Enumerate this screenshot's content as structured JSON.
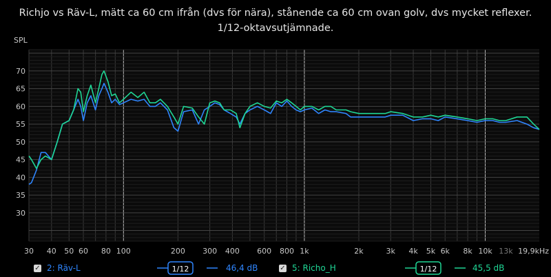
{
  "title_lines": [
    "Richjo vs Räv-L, mätt ca 60 cm ifrån (dvs för nära), stånende ca 60 cm ovan golv, dvs mycket reflexer.",
    "1/12-oktavsutjämnade."
  ],
  "colors": {
    "rav": "#2f86ff",
    "richo": "#1fd796",
    "grid": "#3a3a3a",
    "grid_major": "#bdbdbd",
    "text": "#c8c8c8"
  },
  "chart_data": {
    "type": "line",
    "title": "Richjo vs Räv-L, mätt ca 60 cm ifrån (dvs för nära), stånende ca 60 cm ovan golv, dvs mycket reflexer. 1/12-oktavsutjämnade.",
    "xlabel": "Hz",
    "ylabel": "SPL",
    "xscale": "log",
    "xlim": [
      30,
      19900
    ],
    "ylim": [
      22,
      76
    ],
    "grid": true,
    "y_ticks": [
      30,
      35,
      40,
      45,
      50,
      55,
      60,
      65,
      70
    ],
    "x_ticks": [
      {
        "v": 30,
        "label": "30"
      },
      {
        "v": 40,
        "label": "40"
      },
      {
        "v": 50,
        "label": "50"
      },
      {
        "v": 60,
        "label": "60"
      },
      {
        "v": 80,
        "label": "80"
      },
      {
        "v": 100,
        "label": "100"
      },
      {
        "v": 200,
        "label": "200"
      },
      {
        "v": 300,
        "label": "300"
      },
      {
        "v": 400,
        "label": "400"
      },
      {
        "v": 600,
        "label": "600"
      },
      {
        "v": 800,
        "label": "800"
      },
      {
        "v": 1000,
        "label": "1k"
      },
      {
        "v": 2000,
        "label": "2k"
      },
      {
        "v": 3000,
        "label": "3k"
      },
      {
        "v": 4000,
        "label": "4k"
      },
      {
        "v": 5000,
        "label": "5k"
      },
      {
        "v": 6000,
        "label": "6k"
      },
      {
        "v": 8000,
        "label": "8k"
      },
      {
        "v": 10000,
        "label": "10k"
      },
      {
        "v": 13000,
        "label": "13k"
      },
      {
        "v": 19900,
        "label": "19,9kHz"
      }
    ],
    "series": [
      {
        "name": "2: Räv-L",
        "color": "#2f86ff",
        "points": [
          [
            30,
            38
          ],
          [
            31,
            38.5
          ],
          [
            33,
            42
          ],
          [
            35,
            47
          ],
          [
            37,
            47
          ],
          [
            40,
            45
          ],
          [
            43,
            50
          ],
          [
            46,
            55
          ],
          [
            50,
            56
          ],
          [
            53,
            59
          ],
          [
            56,
            62
          ],
          [
            58,
            60
          ],
          [
            60,
            56
          ],
          [
            63,
            61
          ],
          [
            66,
            63
          ],
          [
            70,
            59
          ],
          [
            73,
            63
          ],
          [
            76,
            65
          ],
          [
            78,
            66.5
          ],
          [
            82,
            64
          ],
          [
            86,
            61
          ],
          [
            90,
            62
          ],
          [
            95,
            60.5
          ],
          [
            100,
            61
          ],
          [
            110,
            62
          ],
          [
            120,
            61.5
          ],
          [
            130,
            62
          ],
          [
            140,
            60
          ],
          [
            150,
            60
          ],
          [
            160,
            61
          ],
          [
            175,
            59
          ],
          [
            190,
            54
          ],
          [
            200,
            53
          ],
          [
            215,
            58.5
          ],
          [
            240,
            59
          ],
          [
            260,
            55
          ],
          [
            280,
            59
          ],
          [
            300,
            60
          ],
          [
            320,
            61
          ],
          [
            340,
            60.5
          ],
          [
            360,
            59
          ],
          [
            390,
            58
          ],
          [
            420,
            57
          ],
          [
            440,
            55
          ],
          [
            470,
            58
          ],
          [
            500,
            59
          ],
          [
            550,
            60
          ],
          [
            600,
            59
          ],
          [
            650,
            58
          ],
          [
            700,
            61
          ],
          [
            750,
            60
          ],
          [
            800,
            61.5
          ],
          [
            850,
            60
          ],
          [
            900,
            59
          ],
          [
            950,
            58.5
          ],
          [
            1000,
            59
          ],
          [
            1100,
            59.5
          ],
          [
            1200,
            58
          ],
          [
            1300,
            59
          ],
          [
            1400,
            58.5
          ],
          [
            1500,
            58.5
          ],
          [
            1700,
            58
          ],
          [
            1800,
            57
          ],
          [
            2000,
            57
          ],
          [
            2200,
            57
          ],
          [
            2500,
            57
          ],
          [
            2800,
            57
          ],
          [
            3000,
            57.5
          ],
          [
            3500,
            57.5
          ],
          [
            4000,
            56
          ],
          [
            4500,
            56.5
          ],
          [
            5000,
            56.5
          ],
          [
            5500,
            56
          ],
          [
            6000,
            57
          ],
          [
            7000,
            56.5
          ],
          [
            8000,
            56
          ],
          [
            9000,
            55.5
          ],
          [
            10000,
            56
          ],
          [
            11000,
            56
          ],
          [
            12000,
            55.5
          ],
          [
            13000,
            55.5
          ],
          [
            15000,
            56
          ],
          [
            17000,
            55
          ],
          [
            18500,
            54
          ],
          [
            19900,
            53.5
          ]
        ]
      },
      {
        "name": "5: Richo_H",
        "color": "#1fd796",
        "points": [
          [
            30,
            46
          ],
          [
            31,
            45
          ],
          [
            33,
            42.5
          ],
          [
            35,
            45
          ],
          [
            37,
            46
          ],
          [
            40,
            45
          ],
          [
            43,
            50
          ],
          [
            46,
            55
          ],
          [
            50,
            56
          ],
          [
            53,
            59
          ],
          [
            56,
            65
          ],
          [
            58,
            64
          ],
          [
            60,
            58.5
          ],
          [
            63,
            63
          ],
          [
            66,
            66
          ],
          [
            70,
            61
          ],
          [
            73,
            65
          ],
          [
            76,
            69
          ],
          [
            78,
            70
          ],
          [
            82,
            67
          ],
          [
            86,
            63
          ],
          [
            90,
            63.5
          ],
          [
            95,
            61
          ],
          [
            100,
            62
          ],
          [
            110,
            64
          ],
          [
            120,
            62.5
          ],
          [
            130,
            64
          ],
          [
            140,
            61
          ],
          [
            150,
            61
          ],
          [
            160,
            62
          ],
          [
            175,
            60
          ],
          [
            190,
            57
          ],
          [
            200,
            55
          ],
          [
            215,
            60
          ],
          [
            240,
            59.5
          ],
          [
            260,
            57
          ],
          [
            280,
            55
          ],
          [
            300,
            61
          ],
          [
            320,
            61.5
          ],
          [
            340,
            61
          ],
          [
            360,
            59
          ],
          [
            390,
            59
          ],
          [
            420,
            58
          ],
          [
            440,
            54
          ],
          [
            470,
            58
          ],
          [
            500,
            60
          ],
          [
            550,
            61
          ],
          [
            600,
            60
          ],
          [
            650,
            59.5
          ],
          [
            700,
            61.5
          ],
          [
            750,
            61
          ],
          [
            800,
            62
          ],
          [
            850,
            61
          ],
          [
            900,
            60
          ],
          [
            950,
            59
          ],
          [
            1000,
            60
          ],
          [
            1100,
            60
          ],
          [
            1200,
            59
          ],
          [
            1300,
            60
          ],
          [
            1400,
            60
          ],
          [
            1500,
            59
          ],
          [
            1700,
            59
          ],
          [
            1800,
            58.5
          ],
          [
            2000,
            58
          ],
          [
            2200,
            58
          ],
          [
            2500,
            58
          ],
          [
            2800,
            58
          ],
          [
            3000,
            58.5
          ],
          [
            3500,
            58
          ],
          [
            4000,
            57
          ],
          [
            4500,
            57
          ],
          [
            5000,
            57.5
          ],
          [
            5500,
            57
          ],
          [
            6000,
            57.5
          ],
          [
            7000,
            57
          ],
          [
            8000,
            56.5
          ],
          [
            9000,
            56
          ],
          [
            10000,
            56.5
          ],
          [
            11000,
            56.5
          ],
          [
            12000,
            56
          ],
          [
            13000,
            56
          ],
          [
            15000,
            57
          ],
          [
            17000,
            57
          ],
          [
            18500,
            55
          ],
          [
            19900,
            53.5
          ]
        ]
      }
    ]
  },
  "legend": [
    {
      "checked": true,
      "label": "2: Räv-L",
      "smoothing": "1/12",
      "value": "46,4 dB",
      "color": "#2f86ff"
    },
    {
      "checked": true,
      "label": "5: Richo_H",
      "smoothing": "1/12",
      "value": "45,5 dB",
      "color": "#1fd796"
    }
  ]
}
